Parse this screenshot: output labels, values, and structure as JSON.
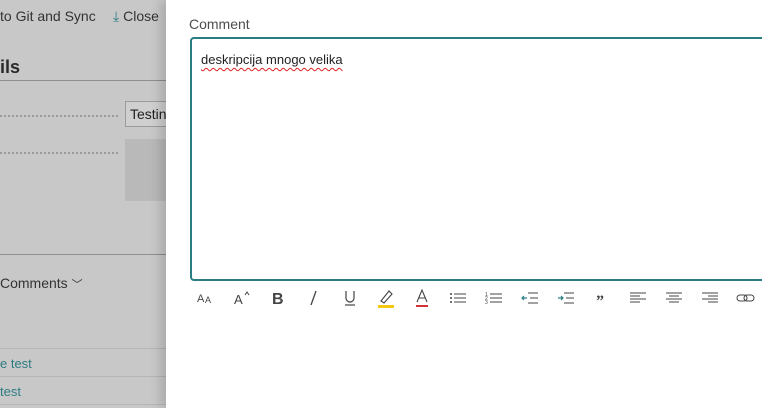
{
  "background": {
    "commands": {
      "git_sync": "to Git and Sync",
      "close": "Close"
    },
    "section_title": "ils",
    "field_value": "Testin",
    "comments_label": "Comments",
    "links": [
      "e test",
      "test"
    ]
  },
  "panel": {
    "comment_label": "Comment",
    "editor_text": "deskripcija mnogo velika"
  },
  "toolbar": {
    "buttons": [
      "font-size-icon",
      "superscript-icon",
      "bold-icon",
      "italic-icon",
      "underline-icon",
      "highlight-icon",
      "font-color-icon",
      "bullet-list-icon",
      "numbered-list-icon",
      "outdent-icon",
      "indent-icon",
      "quote-icon",
      "align-left-icon",
      "align-center-icon",
      "align-right-icon",
      "link-icon"
    ],
    "highlight_color": "#f2c811",
    "font_color": "#d13438"
  },
  "colors": {
    "accent": "#2a7d82",
    "link": "#2f7d84"
  }
}
